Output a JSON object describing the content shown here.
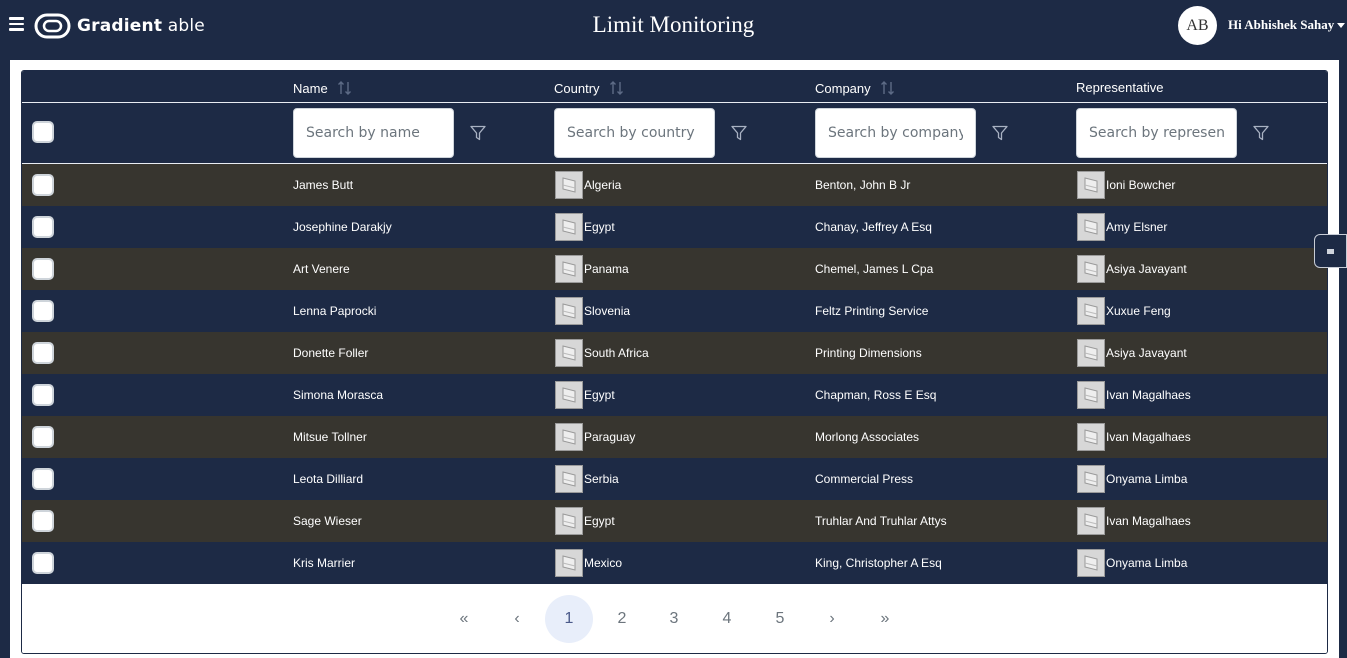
{
  "header": {
    "brand_bold": "Gradient",
    "brand_light": " able",
    "title": "Limit Monitoring",
    "avatar_initials": "AB",
    "greeting": "Hi Abhishek Sahay"
  },
  "table": {
    "columns": [
      {
        "label": "Name",
        "placeholder": "Search by name",
        "sortable": true
      },
      {
        "label": "Country",
        "placeholder": "Search by country",
        "sortable": true
      },
      {
        "label": "Company",
        "placeholder": "Search by company",
        "sortable": true
      },
      {
        "label": "Representative",
        "placeholder": "Search by representative",
        "sortable": false
      }
    ],
    "rows": [
      {
        "name": "James Butt",
        "country": "Algeria",
        "company": "Benton, John B Jr",
        "representative": "Ioni Bowcher"
      },
      {
        "name": "Josephine Darakjy",
        "country": "Egypt",
        "company": "Chanay, Jeffrey A Esq",
        "representative": "Amy Elsner"
      },
      {
        "name": "Art Venere",
        "country": "Panama",
        "company": "Chemel, James L Cpa",
        "representative": "Asiya Javayant"
      },
      {
        "name": "Lenna Paprocki",
        "country": "Slovenia",
        "company": "Feltz Printing Service",
        "representative": "Xuxue Feng"
      },
      {
        "name": "Donette Foller",
        "country": "South Africa",
        "company": "Printing Dimensions",
        "representative": "Asiya Javayant"
      },
      {
        "name": "Simona Morasca",
        "country": "Egypt",
        "company": "Chapman, Ross E Esq",
        "representative": "Ivan Magalhaes"
      },
      {
        "name": "Mitsue Tollner",
        "country": "Paraguay",
        "company": "Morlong Associates",
        "representative": "Ivan Magalhaes"
      },
      {
        "name": "Leota Dilliard",
        "country": "Serbia",
        "company": "Commercial Press",
        "representative": "Onyama Limba"
      },
      {
        "name": "Sage Wieser",
        "country": "Egypt",
        "company": "Truhlar And Truhlar Attys",
        "representative": "Ivan Magalhaes"
      },
      {
        "name": "Kris Marrier",
        "country": "Mexico",
        "company": "King, Christopher A Esq",
        "representative": "Onyama Limba"
      }
    ]
  },
  "pagination": {
    "first": "«",
    "prev": "‹",
    "pages": [
      "1",
      "2",
      "3",
      "4",
      "5"
    ],
    "current_page": "1",
    "next": "›",
    "last": "»"
  },
  "colors": {
    "navy": "#1d2a45",
    "row_dark": "#37352f",
    "active_page_bg": "#e8eefa"
  },
  "icons": {
    "menu": "hamburger-menu-icon",
    "sort": "sort-icon",
    "filter": "filter-icon",
    "flag": "flag-thumbnail",
    "rep": "representative-avatar-thumbnail"
  }
}
